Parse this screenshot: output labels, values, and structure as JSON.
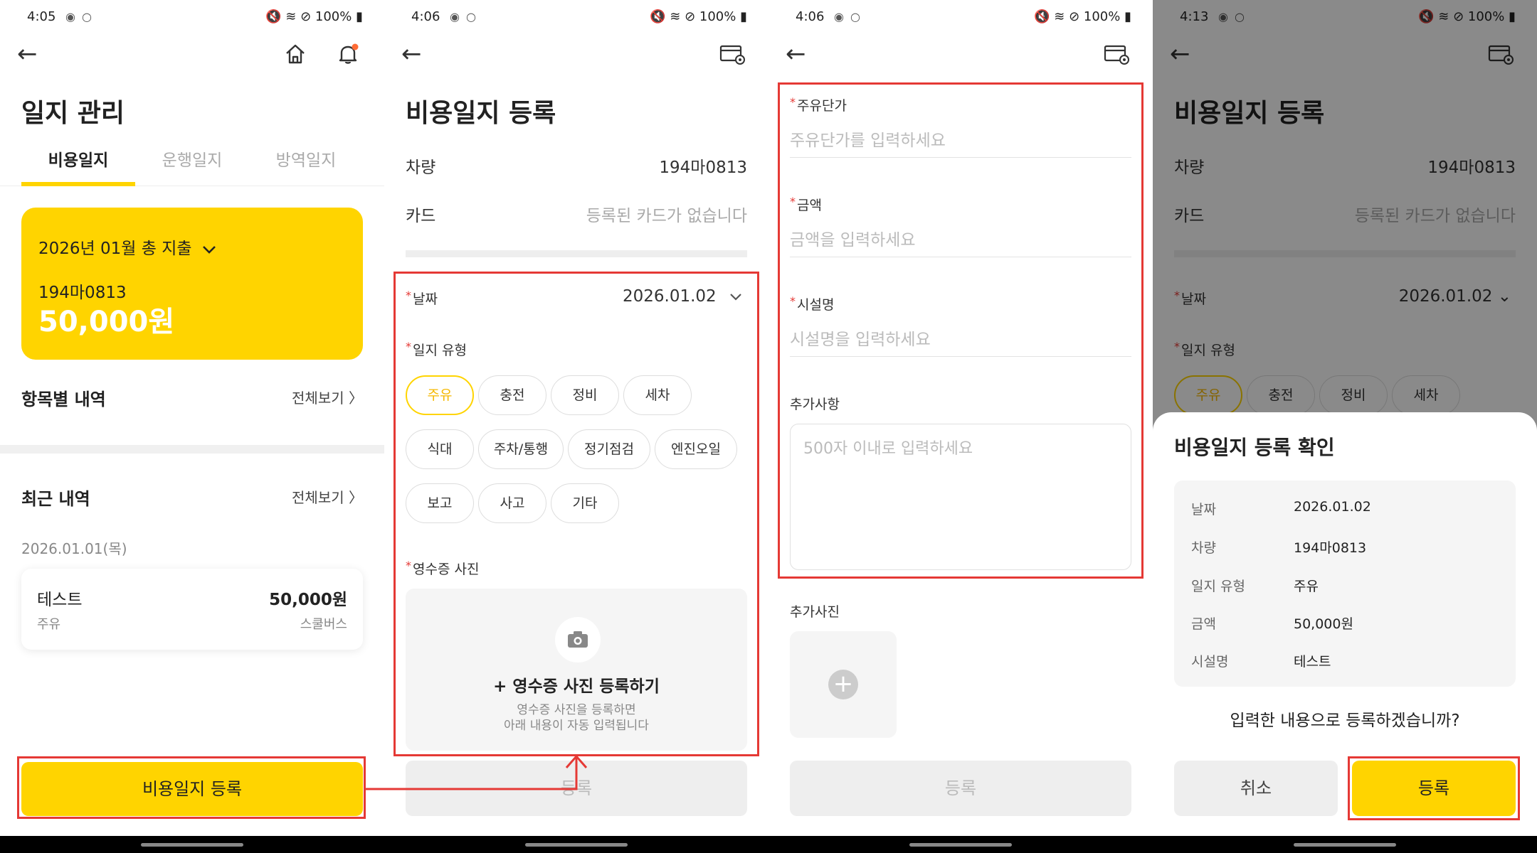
{
  "status": {
    "s1_time": "4:05",
    "s2_time": "4:06",
    "s3_time": "4:06",
    "s4_time": "4:13",
    "battery": "100%"
  },
  "icons": {
    "back": "arrow-left-icon",
    "home": "home-icon",
    "bell": "bell-icon",
    "card": "card-settings-icon",
    "chevron": "chevron-down-icon",
    "camera": "camera-icon",
    "plus": "plus-icon"
  },
  "colors": {
    "accent": "#ffd400",
    "highlight": "#e53935",
    "bell_dot": "#ff6b35"
  },
  "screen1": {
    "title": "일지 관리",
    "tabs": [
      "비용일지",
      "운행일지",
      "방역일지"
    ],
    "summary_month": "2026년 01월 총 지출",
    "summary_plate": "194마0813",
    "summary_amount": "50,000원",
    "by_item_title": "항목별 내역",
    "recent_title": "최근 내역",
    "view_all": "전체보기",
    "recent_date": "2026.01.01(목)",
    "recent_item": {
      "name": "테스트",
      "type": "주유",
      "amount": "50,000원",
      "vehicle": "스쿨버스"
    },
    "register_button": "비용일지 등록"
  },
  "screen2": {
    "title": "비용일지 등록",
    "vehicle_label": "차량",
    "vehicle_value": "194마0813",
    "card_label": "카드",
    "card_value": "등록된 카드가 없습니다",
    "date_label": "날짜",
    "date_value": "2026.01.02",
    "type_label": "일지 유형",
    "types": [
      "주유",
      "충전",
      "정비",
      "세차",
      "식대",
      "주차/통행",
      "정기점검",
      "엔진오일",
      "보고",
      "사고",
      "기타"
    ],
    "receipt_label": "영수증 사진",
    "upload_title": "+ 영수증 사진 등록하기",
    "upload_sub1": "영수증 사진을 등록하면",
    "upload_sub2": "아래 내용이 자동 입력됩니다",
    "submit": "등록"
  },
  "screen3": {
    "unit_price_label": "주유단가",
    "unit_price_placeholder": "주유단가를 입력하세요",
    "amount_label": "금액",
    "amount_placeholder": "금액을 입력하세요",
    "facility_label": "시설명",
    "facility_placeholder": "시설명을 입력하세요",
    "extra_label": "추가사항",
    "extra_placeholder": "500자 이내로 입력하세요",
    "photo_label": "추가사진",
    "submit": "등록"
  },
  "screen4": {
    "sheet_title": "비용일지 등록 확인",
    "rows": [
      {
        "k": "날짜",
        "v": "2026.01.02"
      },
      {
        "k": "차량",
        "v": "194마0813"
      },
      {
        "k": "일지 유형",
        "v": "주유"
      },
      {
        "k": "금액",
        "v": "50,000원"
      },
      {
        "k": "시설명",
        "v": "테스트"
      }
    ],
    "question": "입력한 내용으로 등록하겠습니까?",
    "cancel": "취소",
    "confirm": "등록"
  }
}
